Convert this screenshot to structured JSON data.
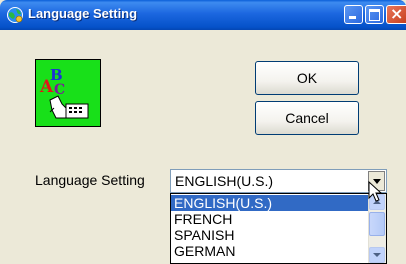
{
  "window": {
    "title": "Language Setting",
    "icon": "globe-gear-icon",
    "caption_buttons": [
      "minimize",
      "maximize",
      "close"
    ]
  },
  "app_icon": "language-abc-hand-keyboard-icon",
  "buttons": {
    "ok": "OK",
    "cancel": "Cancel"
  },
  "language": {
    "label": "Language Setting",
    "selected": "ENGLISH(U.S.)",
    "options": [
      "ENGLISH(U.S.)",
      "FRENCH",
      "SPANISH",
      "GERMAN"
    ],
    "highlighted_option": "ENGLISH(U.S.)"
  },
  "colors": {
    "titlebar": "#0552C9",
    "dialog_background": "#ECE9D8",
    "selection": "#316AC5",
    "icon_background": "#18E019"
  }
}
